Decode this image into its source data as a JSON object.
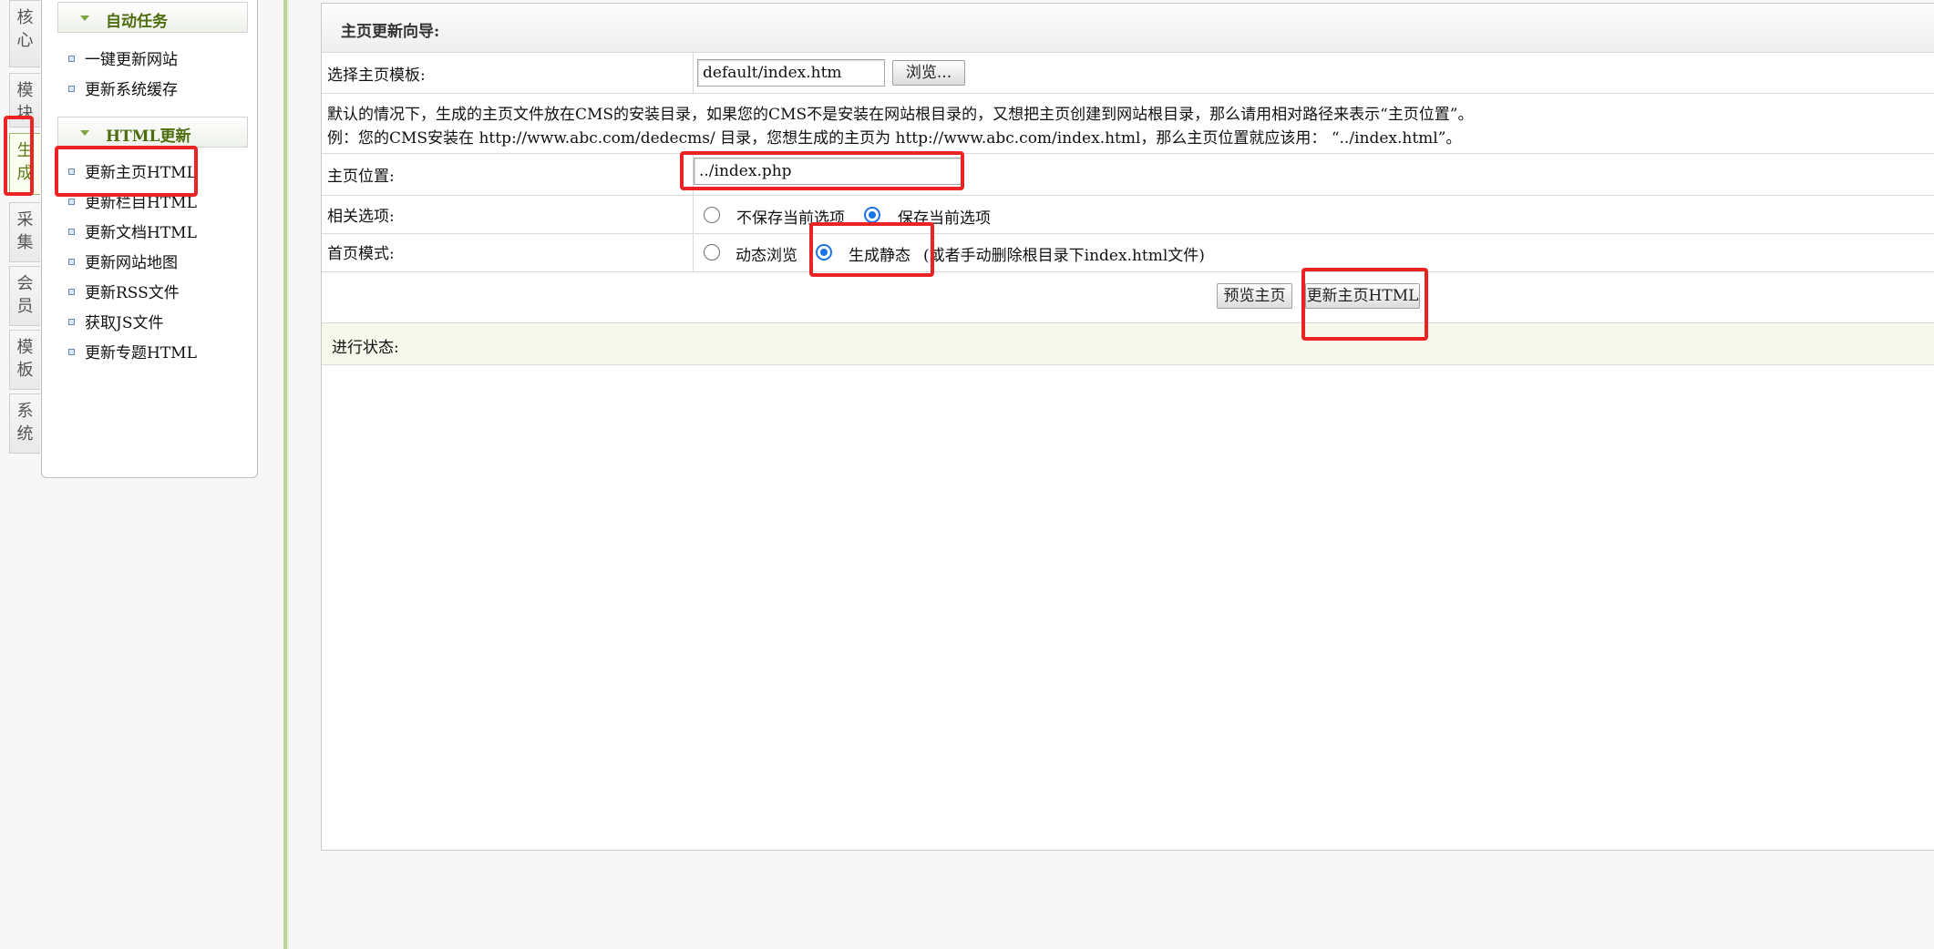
{
  "vertical_tabs": [
    {
      "label": "核心",
      "active": false
    },
    {
      "label": "模块",
      "active": false
    },
    {
      "label": "生成",
      "active": true
    },
    {
      "label": "采集",
      "active": false
    },
    {
      "label": "会员",
      "active": false
    },
    {
      "label": "模板",
      "active": false
    },
    {
      "label": "系统",
      "active": false
    }
  ],
  "sidebar": {
    "sections": [
      {
        "title": "自动任务",
        "items": [
          "一键更新网站",
          "更新系统缓存"
        ]
      },
      {
        "title": "HTML更新",
        "items": [
          "更新主页HTML",
          "更新栏目HTML",
          "更新文档HTML",
          "更新网站地图",
          "更新RSS文件",
          "获取JS文件",
          "更新专题HTML"
        ]
      }
    ]
  },
  "main": {
    "title": "主页更新向导:",
    "template_label": "选择主页模板:",
    "template_value": "default/index.htm",
    "browse_button": "浏览...",
    "note_line1": "默认的情况下，生成的主页文件放在CMS的安装目录，如果您的CMS不是安装在网站根目录的，又想把主页创建到网站根目录，那么请用相对路径来表示“主页位置”。",
    "note_line2": "例：您的CMS安装在 http://www.abc.com/dedecms/ 目录，您想生成的主页为 http://www.abc.com/index.html，那么主页位置就应该用： “../index.html”。",
    "position_label": "主页位置:",
    "position_value": "../index.php",
    "options_label": "相关选项:",
    "option_no_save": "不保存当前选项",
    "option_save": "保存当前选项",
    "option_selected": "保存当前选项",
    "mode_label": "首页模式:",
    "mode_dynamic": "动态浏览",
    "mode_static": "生成静态",
    "mode_selected": "生成静态",
    "mode_note": "(或者手动删除根目录下index.html文件)",
    "preview_button": "预览主页",
    "update_button": "更新主页HTML",
    "status_label": "进行状态:"
  },
  "colors": {
    "highlight": "#ea2424",
    "accent_green": "#4e6d0f",
    "radio_blue": "#1a73e8"
  }
}
